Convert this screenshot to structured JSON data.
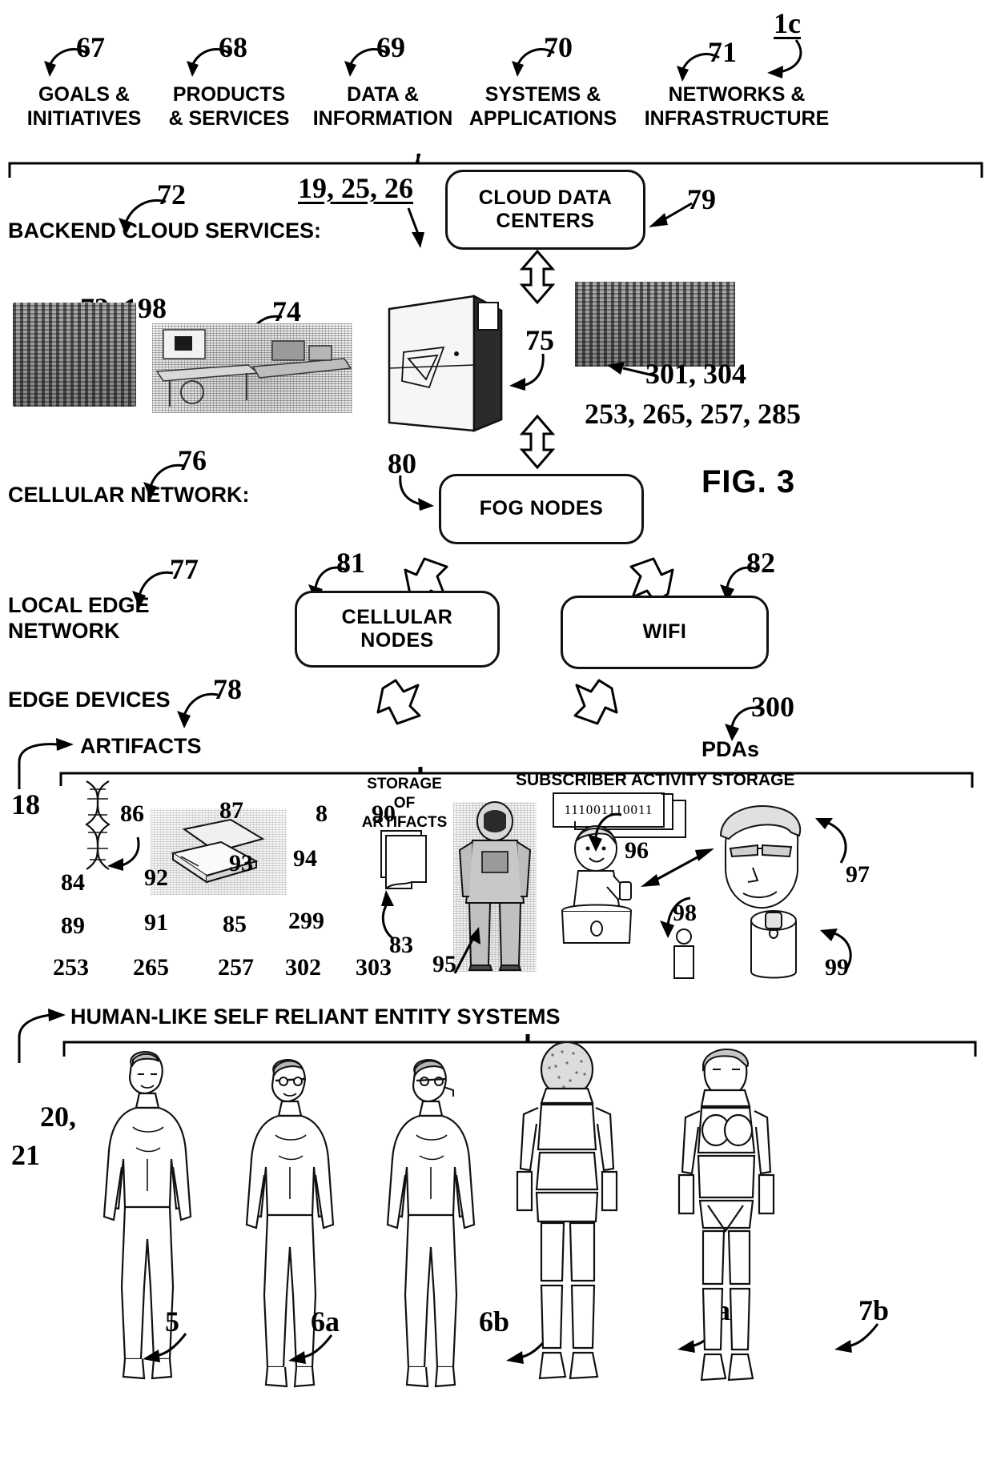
{
  "figure": {
    "title": "FIG. 3",
    "sheet_ref": "1c"
  },
  "columns": [
    {
      "ref": "67",
      "label": "GOALS &\nINITIATIVES"
    },
    {
      "ref": "68",
      "label": "PRODUCTS\n& SERVICES"
    },
    {
      "ref": "69",
      "label": "DATA &\nINFORMATION"
    },
    {
      "ref": "70",
      "label": "SYSTEMS &\nAPPLICATIONS"
    },
    {
      "ref": "71",
      "label": "NETWORKS &\nINFRASTRUCTURE"
    }
  ],
  "tiers": {
    "backend": {
      "ref": "72",
      "label": "BACKEND CLOUD SERVICES:"
    },
    "cellular": {
      "ref": "76",
      "label": "CELLULAR NETWORK:"
    },
    "local_edge": {
      "ref": "77",
      "label": "LOCAL EDGE\nNETWORK"
    },
    "edge_devices": {
      "ref": "78",
      "label": "EDGE DEVICES"
    }
  },
  "boxes": {
    "cloud_data_centers": {
      "ref": "79",
      "label": "CLOUD DATA\nCENTERS"
    },
    "fog_nodes": {
      "ref": "80",
      "label": "FOG NODES"
    },
    "cellular_nodes": {
      "ref": "81",
      "label": "CELLULAR\nNODES"
    },
    "wifi": {
      "ref": "82",
      "label": "WIFI"
    }
  },
  "refs": {
    "server_stack_ref": "19, 25, 26",
    "racks_left": "73, 198",
    "workstation": "74",
    "mainframe_link": "75",
    "racks_right": "301, 304",
    "racks_right_second": "253, 265, 257, 285",
    "pdas": "300",
    "dna_ref": "18",
    "artifact_86": "86",
    "artifact_87": "87",
    "storage_of_artifacts": "83",
    "astronaut": "95",
    "child": "96",
    "subscriber": "97",
    "device_98": "98",
    "device_99": "99",
    "entities_ref": "20,\n21"
  },
  "artifacts_panel": {
    "heading": "ARTIFACTS",
    "grid": [
      [
        "86",
        "87",
        "8",
        "90"
      ],
      [
        "84",
        "92",
        "93",
        "94"
      ],
      [
        "89",
        "91",
        "85",
        "299"
      ],
      [
        "253",
        "265",
        "257",
        "302",
        "303"
      ]
    ]
  },
  "storage_panel": {
    "label": "STORAGE\nOF\nARTIFACTS"
  },
  "subscriber_panel": {
    "heading": "SUBSCRIBER ACTIVITY STORAGE",
    "binary": "111001110011",
    "pdas_label": "PDAs"
  },
  "entities_panel": {
    "heading": "HUMAN-LIKE SELF RELIANT ENTITY SYSTEMS",
    "figures": [
      {
        "ref": "5",
        "kind": "human-male"
      },
      {
        "ref": "6a",
        "kind": "human-male-augmented"
      },
      {
        "ref": "6b",
        "kind": "human-male-augmented"
      },
      {
        "ref": "7a",
        "kind": "robot-male"
      },
      {
        "ref": "7b",
        "kind": "robot-female"
      }
    ]
  },
  "colors": {
    "ink": "#000000",
    "paper": "#ffffff"
  }
}
